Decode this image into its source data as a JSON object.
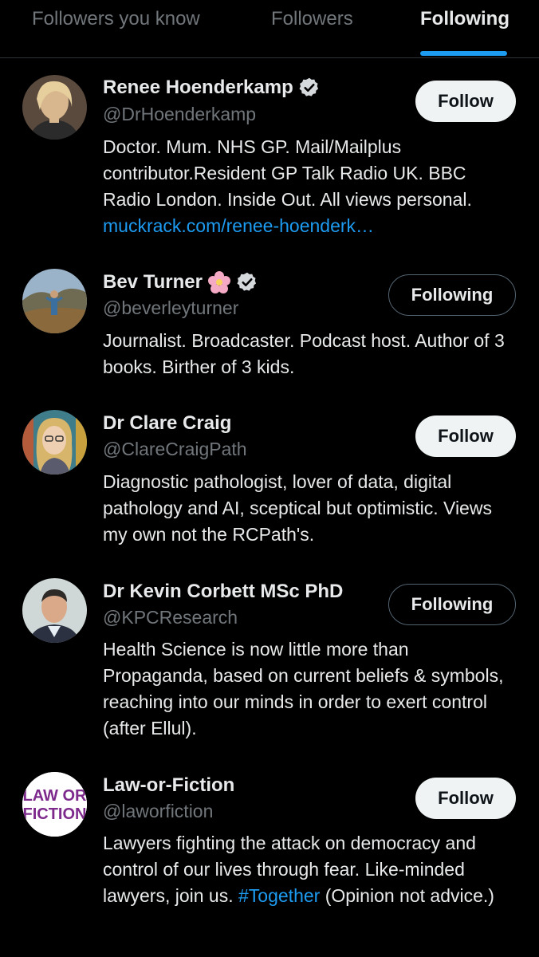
{
  "tabs": [
    {
      "label": "Followers you know",
      "active": false
    },
    {
      "label": "Followers",
      "active": false
    },
    {
      "label": "Following",
      "active": true
    }
  ],
  "colors": {
    "accent": "#1d9bf0",
    "background": "#000000",
    "secondary_text": "#71767b"
  },
  "users": [
    {
      "name": "Renee Hoenderkamp",
      "handle": "@DrHoenderkamp",
      "verified": true,
      "button": "Follow",
      "bio": "Doctor. Mum. NHS GP. Mail/Mailplus contributor.Resident GP Talk Radio UK. BBC Radio London. Inside Out. All views personal.",
      "link": "muckrack.com/renee-hoenderk…"
    },
    {
      "name": "Bev Turner",
      "handle": "@beverleyturner",
      "verified": true,
      "emoji": "cherry-blossom-icon",
      "button": "Following",
      "bio": "Journalist. Broadcaster. Podcast host. Author of 3 books. Birther of 3 kids."
    },
    {
      "name": "Dr Clare Craig",
      "handle": "@ClareCraigPath",
      "verified": false,
      "button": "Follow",
      "bio": "Diagnostic pathologist, lover of data, digital pathology and AI, sceptical but optimistic. Views my own not the RCPath's."
    },
    {
      "name": "Dr Kevin Corbett MSc PhD",
      "handle": "@KPCResearch",
      "verified": false,
      "button": "Following",
      "bio": "Health Science is now little more than Propaganda, based on current beliefs & symbols, reaching into our minds in order to exert control (after Ellul)."
    },
    {
      "name": "Law-or-Fiction",
      "handle": "@laworfiction",
      "verified": false,
      "button": "Follow",
      "bio_before": "Lawyers fighting the attack on democracy and control of our lives through fear. Like-minded lawyers, join us. ",
      "bio_hashtag": "#Together",
      "bio_after": " (Opinion not advice.)",
      "avatar_logo": {
        "line1": "LAW OR",
        "line2": "FICTION"
      }
    }
  ]
}
